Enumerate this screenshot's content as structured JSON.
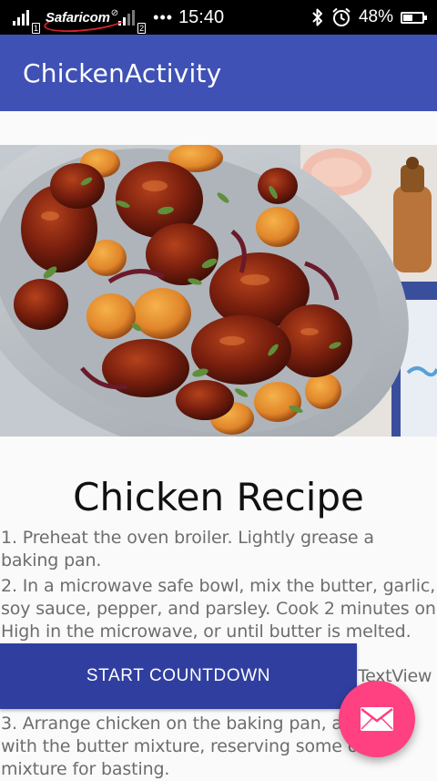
{
  "status_bar": {
    "carrier": "Safaricom",
    "sim1": "1",
    "sim2": "2",
    "more": "•••",
    "time": "15:40",
    "battery_percent": "48%",
    "battery_level": 0.48,
    "icons": [
      "signal-icon",
      "no-sim-icon",
      "bluetooth-icon",
      "alarm-icon",
      "battery-icon"
    ]
  },
  "app_bar": {
    "title": "ChickenActivity",
    "color": "#3f51b5"
  },
  "hero_image": {
    "subject": "roast-chicken-dish"
  },
  "recipe": {
    "title": "Chicken Recipe",
    "steps": [
      "1. Preheat the oven broiler. Lightly grease a baking pan.",
      "2. In a microwave safe bowl, mix the butter, garlic, soy sauce, pepper, and parsley. Cook 2 minutes on High in the microwave, or until butter is melted.",
      "3. Arrange chicken on the baking pan, and coat with the butter mixture, reserving some of the mixture for basting."
    ]
  },
  "actions": {
    "countdown_label": "START COUNTDOWN",
    "countdown_color": "#303f9f",
    "textview_label": "TextView"
  },
  "fab": {
    "icon": "mail-icon",
    "color": "#ff4081"
  }
}
